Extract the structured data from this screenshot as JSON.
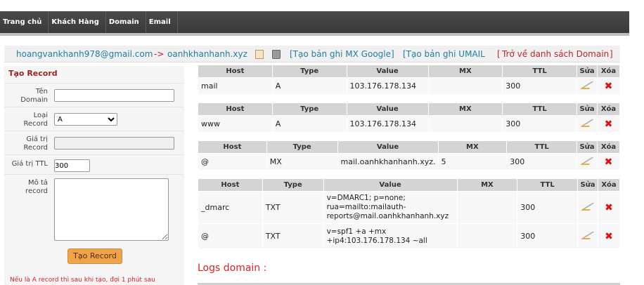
{
  "nav": [
    "Trang chủ",
    "Khách Hàng",
    "Domain",
    "Email"
  ],
  "bread": {
    "email": "hoangvankhanh978@gmail.com",
    "arrow": "->",
    "domain": "oanhkhanhanh.xyz",
    "mx_google": "[Tạo bản ghi MX Google]",
    "umail": "[Tạo bản ghi UMAIL",
    "back_open": "[",
    "back": "Trở về danh sách Domain",
    "back_close": "]"
  },
  "form": {
    "title": "Tạo Record",
    "domain_label": "Tên Domain",
    "type_label": "Loại Record",
    "type_value": "A",
    "value_label": "Giá trị Record",
    "ttl_label": "Giá trị TTL",
    "ttl_value": "300",
    "desc_label": "Mô tả record",
    "submit": "Tạo Record",
    "note": "Nếu là A record thì sau khi tạo, đợi 1 phút sau"
  },
  "columns": [
    "Host",
    "Type",
    "Value",
    "MX",
    "TTL",
    "Sửa",
    "Xóa"
  ],
  "records": [
    {
      "host": "mail",
      "type": "A",
      "value": "103.176.178.134",
      "mx": "",
      "ttl": "300"
    },
    {
      "host": "www",
      "type": "A",
      "value": "103.176.178.134",
      "mx": "",
      "ttl": "300"
    },
    {
      "host": "@",
      "type": "MX",
      "value": "mail.oanhkhanhanh.xyz.",
      "mx": "5",
      "ttl": "300"
    }
  ],
  "txt_records": [
    {
      "host": "_dmarc",
      "type": "TXT",
      "value_lines": [
        "v=DMARC1; p=none;",
        "rua=mailto:mailauth-",
        "reports@mail.oanhkhanhanh.xyz"
      ],
      "mx": "",
      "ttl": "300"
    },
    {
      "host": "@",
      "type": "TXT",
      "value_lines": [
        "v=spf1 +a +mx",
        "+ip4:103.176.178.134 ~all"
      ],
      "mx": "",
      "ttl": "300"
    }
  ],
  "logs_title": "Logs domain :"
}
